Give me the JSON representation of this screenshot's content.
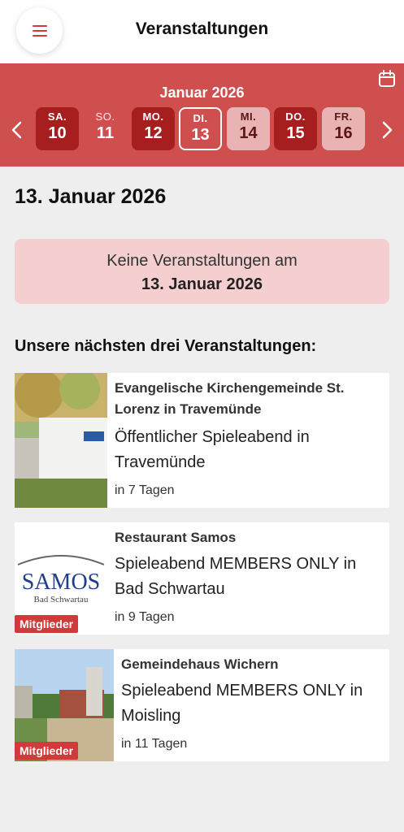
{
  "header": {
    "title": "Veranstaltungen",
    "menu_icon": "menu-icon"
  },
  "calendar": {
    "month": "Januar 2026",
    "icon": "calendar-icon",
    "days": [
      {
        "name": "SA.",
        "num": "10",
        "style": "dark"
      },
      {
        "name": "SO.",
        "num": "11",
        "style": "plain"
      },
      {
        "name": "MO.",
        "num": "12",
        "style": "dark"
      },
      {
        "name": "DI.",
        "num": "13",
        "style": "selected"
      },
      {
        "name": "MI.",
        "num": "14",
        "style": "light"
      },
      {
        "name": "DO.",
        "num": "15",
        "style": "dark"
      },
      {
        "name": "FR.",
        "num": "16",
        "style": "light"
      }
    ]
  },
  "main": {
    "date_heading": "13. Januar 2026",
    "no_events_line1": "Keine Veranstaltungen am",
    "no_events_line2": "13. Januar 2026",
    "next_heading": "Unsere nächsten drei Veranstaltungen:"
  },
  "events": [
    {
      "host": "Evangelische Kirchengemeinde St. Lorenz in Travemünde",
      "title": "Öffentlicher Spieleabend in Travemünde",
      "when": "in 7 Tagen",
      "badge": ""
    },
    {
      "host": "Restaurant Samos",
      "title": "Spieleabend MEMBERS ONLY in Bad Schwartau",
      "when": "in 9 Tagen",
      "badge": "Mitglieder",
      "logo_text": "SAMOS",
      "logo_subtext": "Bad Schwartau"
    },
    {
      "host": "Gemeindehaus Wichern",
      "title": "Spieleabend MEMBERS ONLY in Moisling",
      "when": "in 11 Tagen",
      "badge": "Mitglieder"
    }
  ],
  "colors": {
    "accent": "#cf4f4f",
    "dark_day": "#a61e1e",
    "light_day": "#e9b3b3",
    "notice_bg": "#f5cfcf"
  }
}
